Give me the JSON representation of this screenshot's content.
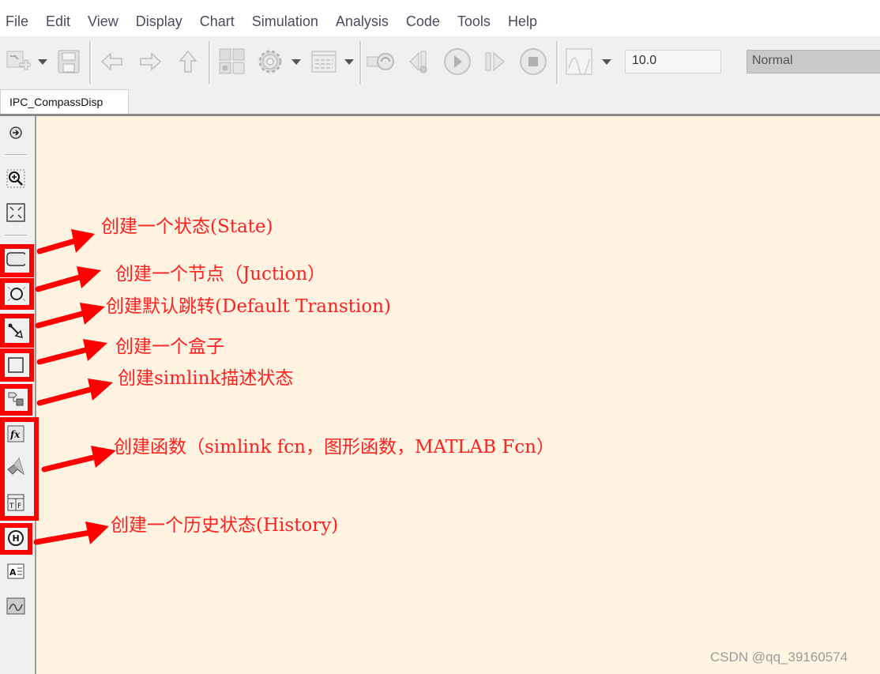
{
  "menubar": {
    "items": [
      "File",
      "Edit",
      "View",
      "Display",
      "Chart",
      "Simulation",
      "Analysis",
      "Code",
      "Tools",
      "Help"
    ]
  },
  "toolbar": {
    "buttons": [
      {
        "name": "new-block-button",
        "icon": "new-block-icon"
      },
      {
        "name": "save-button",
        "icon": "save-icon"
      },
      {
        "name": "back-button",
        "icon": "arrow-left-icon"
      },
      {
        "name": "forward-button",
        "icon": "arrow-right-icon"
      },
      {
        "name": "up-button",
        "icon": "arrow-up-icon"
      },
      {
        "name": "library-browser-button",
        "icon": "library-icon"
      },
      {
        "name": "model-settings-button",
        "icon": "gear-icon"
      },
      {
        "name": "model-explorer-button",
        "icon": "table-icon"
      },
      {
        "name": "update-diagram-button",
        "icon": "refresh-icon"
      },
      {
        "name": "step-back-button",
        "icon": "step-back-icon"
      },
      {
        "name": "run-button",
        "icon": "play-icon"
      },
      {
        "name": "step-forward-button",
        "icon": "step-forward-icon"
      },
      {
        "name": "stop-button",
        "icon": "stop-icon"
      },
      {
        "name": "scope-button",
        "icon": "scope-icon"
      }
    ],
    "stop_time": "10.0",
    "sim_mode": "Normal"
  },
  "tab": {
    "label": "IPC_CompassDisp"
  },
  "palette": {
    "tools": [
      {
        "name": "hide-show-explorer",
        "icon": "arrow-circle-icon"
      },
      {
        "name": "zoom-tool",
        "icon": "zoom-in-icon"
      },
      {
        "name": "fit-to-view",
        "icon": "fit-view-icon"
      },
      {
        "name": "state-tool",
        "icon": "state-icon"
      },
      {
        "name": "junction-tool",
        "icon": "junction-icon"
      },
      {
        "name": "default-transition-tool",
        "icon": "default-transition-icon"
      },
      {
        "name": "box-tool",
        "icon": "box-icon"
      },
      {
        "name": "simulink-state-tool",
        "icon": "simulink-state-icon"
      },
      {
        "name": "graphical-function-tool",
        "icon": "fx-icon"
      },
      {
        "name": "matlab-function-tool",
        "icon": "matlab-icon"
      },
      {
        "name": "truth-table-tool",
        "icon": "truth-table-icon"
      },
      {
        "name": "history-junction-tool",
        "icon": "history-icon"
      },
      {
        "name": "annotation-tool",
        "icon": "annotation-icon"
      },
      {
        "name": "image-tool",
        "icon": "image-icon"
      }
    ]
  },
  "annotations": [
    "创建一个状态(State)",
    "创建一个节点（Juction）",
    "创建默认跳转(Default Transtion)",
    "创建一个盒子",
    "创建simlink描述状态",
    "创建函数（simlink fcn，图形函数，MATLAB Fcn）",
    "创建一个历史状态(History)"
  ],
  "watermark": "CSDN @qq_39160574",
  "colors": {
    "annotation_red": "#ff0000",
    "canvas_bg": "#fff4e2",
    "chrome_bg": "#f0f0f0"
  }
}
